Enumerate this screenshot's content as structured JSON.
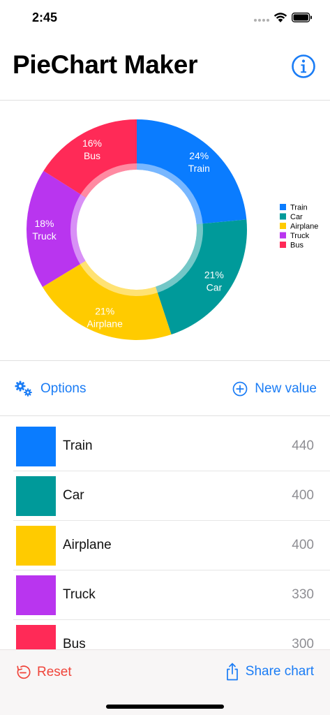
{
  "status_bar": {
    "time": "2:45"
  },
  "header": {
    "title": "PieChart Maker",
    "info_icon": "info-circle-icon"
  },
  "colors": {
    "accent": "#1a7cf5",
    "destructive": "#f0443a",
    "value_gray": "#8e8e93"
  },
  "chart_data": {
    "type": "pie",
    "donut": true,
    "categories": [
      "Train",
      "Car",
      "Airplane",
      "Truck",
      "Bus"
    ],
    "values": [
      440,
      400,
      400,
      330,
      300
    ],
    "percent_labels": [
      "24%",
      "21%",
      "21%",
      "18%",
      "16%"
    ],
    "colors": [
      "#0a7cff",
      "#009a9a",
      "#ffcb00",
      "#b935ef",
      "#ff2a57"
    ],
    "legend": "right",
    "title": ""
  },
  "toolbar": {
    "options_label": "Options",
    "new_value_label": "New value"
  },
  "list": {
    "items": [
      {
        "name": "Train",
        "value": "440",
        "color": "#0a7cff"
      },
      {
        "name": "Car",
        "value": "400",
        "color": "#009a9a"
      },
      {
        "name": "Airplane",
        "value": "400",
        "color": "#ffcb00"
      },
      {
        "name": "Truck",
        "value": "330",
        "color": "#b935ef"
      },
      {
        "name": "Bus",
        "value": "300",
        "color": "#ff2a57"
      }
    ]
  },
  "bottom_bar": {
    "reset_label": "Reset",
    "share_label": "Share chart"
  }
}
